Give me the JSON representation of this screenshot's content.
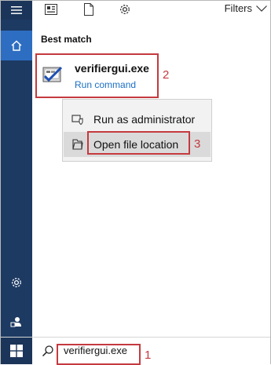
{
  "top_bar": {
    "filters_label": "Filters",
    "icons": [
      "grid-doc-icon",
      "document-icon",
      "settings-gear-icon",
      "chevron-down-icon"
    ]
  },
  "rail": {
    "icons": [
      "hamburger-icon",
      "home-icon",
      "settings-gear-icon",
      "user-icon"
    ]
  },
  "best_match": {
    "heading": "Best match",
    "title": "verifiergui.exe",
    "subtitle": "Run command",
    "icon": "verifiergui-app-icon",
    "callout": "2"
  },
  "context_menu": {
    "items": [
      {
        "label": "Run as administrator",
        "icon": "shield-run-icon"
      },
      {
        "label": "Open file location",
        "icon": "folder-icon"
      }
    ],
    "callout": "3"
  },
  "taskbar": {
    "search_value": "verifiergui.exe",
    "callout": "1",
    "icons": [
      "windows-start-icon",
      "search-icon"
    ]
  },
  "colors": {
    "rail": "#1d3a63",
    "home_active": "#2d6ec2",
    "link_blue": "#1a6fc4",
    "callout_red": "#c43a3f"
  }
}
